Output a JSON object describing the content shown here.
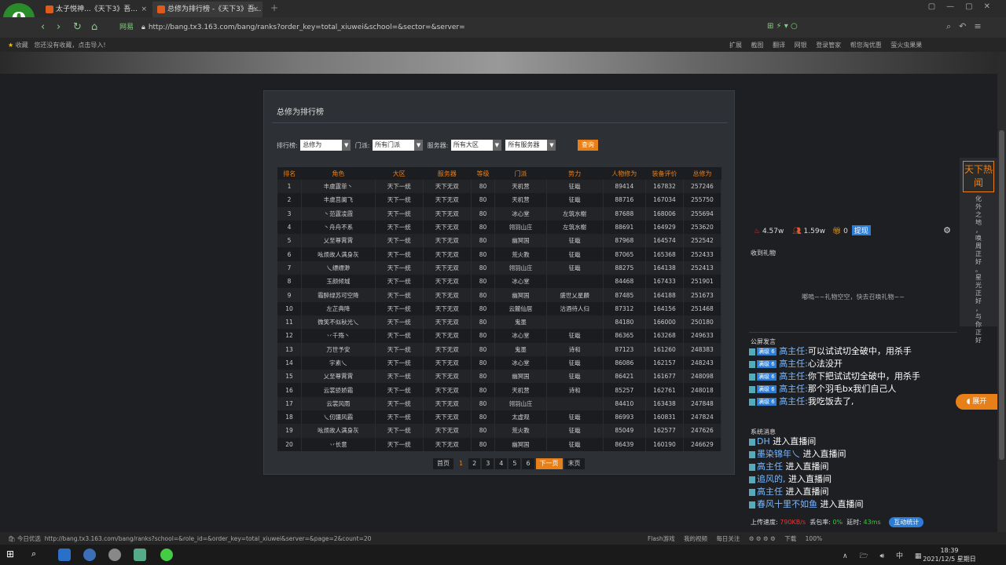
{
  "browser": {
    "logo": "e",
    "tabs": [
      {
        "label": "太子悦神...《天下3》吾..."
      },
      {
        "label": "总修为排行榜 -《天下3》吾..."
      }
    ],
    "url_prefix": "网易",
    "url": "http://bang.tx3.163.com/bang/ranks?order_key=total_xiuwei&school=&sector=&server=",
    "bookmarks_left_label": "收藏",
    "bookmarks_hint": "您还没有收藏，点击导入!",
    "bookmarks_right": [
      "扩展",
      "截图",
      "翻译",
      "网银",
      "登录管家",
      "帮您淘优惠",
      "萤火虫果果"
    ]
  },
  "panel": {
    "title": "总修为排行榜",
    "filters": {
      "rank_label": "排行榜:",
      "rank_value": "总修为",
      "school_label": "门派:",
      "school_value": "所有门派",
      "server_label": "服务器:",
      "region_value": "所有大区",
      "server_value": "所有服务器",
      "query": "查询"
    },
    "columns": [
      "排名",
      "角色",
      "大区",
      "服务器",
      "等级",
      "门派",
      "势力",
      "人物修为",
      "装备评价",
      "总修为"
    ],
    "rows": [
      [
        "1",
        "丰虞霆菲丶",
        "天下一统",
        "天下无双",
        "80",
        "天机营",
        "征戢",
        "89414",
        "167832",
        "257246"
      ],
      [
        "2",
        "丰虞莒阑飞",
        "天下一统",
        "天下无双",
        "80",
        "天机营",
        "征戢",
        "88716",
        "167034",
        "255750"
      ],
      [
        "3",
        "丶范霆凌霞",
        "天下一统",
        "天下无双",
        "80",
        "冰心堂",
        "左筑水榭",
        "87688",
        "168006",
        "255694"
      ],
      [
        "4",
        "丶舟舟不系",
        "天下一统",
        "天下无双",
        "80",
        "翎羽山庄",
        "左筑水榭",
        "88691",
        "164929",
        "253620"
      ],
      [
        "5",
        "乂至尊霄霄",
        "天下一统",
        "天下无双",
        "80",
        "幽冥国",
        "征戢",
        "87968",
        "164574",
        "252542"
      ],
      [
        "6",
        "吆烦故人满身灰",
        "天下一统",
        "天下无双",
        "80",
        "荒火教",
        "征戢",
        "87065",
        "165368",
        "252433"
      ],
      [
        "7",
        "乀缥缥渺",
        "天下一统",
        "天下无双",
        "80",
        "翎羽山庄",
        "征戢",
        "88275",
        "164138",
        "252413"
      ],
      [
        "8",
        "玉颜倾城",
        "天下一统",
        "天下无双",
        "80",
        "冰心堂",
        "",
        "84468",
        "167433",
        "251901"
      ],
      [
        "9",
        "霜醉绿苏可空降",
        "天下一统",
        "天下无双",
        "80",
        "幽冥国",
        "盛世乂星麟",
        "87485",
        "164188",
        "251673"
      ],
      [
        "10",
        "左芷典降",
        "天下一统",
        "天下无双",
        "80",
        "云麓仙居",
        "沽酒待人归",
        "87312",
        "164156",
        "251468"
      ],
      [
        "11",
        "微笑不似秋光乀",
        "天下一统",
        "天下无双",
        "80",
        "鬼墨",
        "",
        "84180",
        "166000",
        "250180"
      ],
      [
        "12",
        "丷千殇丶",
        "天下一统",
        "天下无双",
        "80",
        "冰心堂",
        "征戢",
        "86365",
        "163268",
        "249633"
      ],
      [
        "13",
        "万世予安",
        "天下一统",
        "天下无双",
        "80",
        "鬼墨",
        "诗和",
        "87123",
        "161260",
        "248383"
      ],
      [
        "14",
        "宇素乀",
        "天下一统",
        "天下无双",
        "80",
        "冰心堂",
        "征戢",
        "86086",
        "162157",
        "248243"
      ],
      [
        "15",
        "乂至尊霄霄",
        "天下一统",
        "天下无双",
        "80",
        "幽冥国",
        "征戢",
        "86421",
        "161677",
        "248098"
      ],
      [
        "16",
        "云裳骄娇霜",
        "天下一统",
        "天下无双",
        "80",
        "天机营",
        "诗和",
        "85257",
        "162761",
        "248018"
      ],
      [
        "17",
        "云裳风雨",
        "天下一统",
        "天下无双",
        "80",
        "翎羽山庄",
        "",
        "84410",
        "163438",
        "247848"
      ],
      [
        "18",
        "乀仞疆风霸",
        "天下一统",
        "天下无双",
        "80",
        "太虚观",
        "征戢",
        "86993",
        "160831",
        "247824"
      ],
      [
        "19",
        "吆烦故人满身灰",
        "天下一统",
        "天下无双",
        "80",
        "荒火教",
        "征戢",
        "85049",
        "162577",
        "247626"
      ],
      [
        "20",
        "丷长意",
        "天下一统",
        "天下无双",
        "80",
        "幽冥国",
        "征戢",
        "86439",
        "160190",
        "246629"
      ]
    ],
    "pager": {
      "first": "首页",
      "pages": [
        "1",
        "2",
        "3",
        "4",
        "5",
        "6"
      ],
      "current": "1",
      "next": "下一页",
      "last": "末页"
    }
  },
  "live": {
    "hot": "4.57w",
    "people": "1.59w",
    "gifts": "0",
    "withdraw": "提现",
    "gift_title": "收到礼物",
    "gift_empty": "嘟嗚~~礼物空空，快去召唤礼物~~",
    "public_title": "公屏发言",
    "chat": [
      {
        "level": "满级 6",
        "user": "高主任:",
        "msg": "可以试试切全破中，用杀手"
      },
      {
        "level": "满级 6",
        "user": "高主任:",
        "msg": "心法没开"
      },
      {
        "level": "满级 6",
        "user": "高主任:",
        "msg": "你下把试试切全破中，用杀手"
      },
      {
        "level": "满级 6",
        "user": "高主任:",
        "msg": "那个羽毛bx我们自己人"
      },
      {
        "level": "满级 6",
        "user": "高主任:",
        "msg": "我吃饭去了,"
      }
    ],
    "sys_title": "系统消息",
    "sys": [
      {
        "user": "DH",
        "msg": "进入直播间"
      },
      {
        "user": "墨染锦年乀",
        "msg": "进入直播间"
      },
      {
        "user": "高主任",
        "msg": "进入直播间"
      },
      {
        "user": "追风的,",
        "msg": "进入直播间"
      },
      {
        "user": "高主任",
        "msg": "进入直播间"
      },
      {
        "user": "春风十里不如鱼",
        "msg": "进入直播间"
      }
    ],
    "net": {
      "upload_label": "上传速度:",
      "upload": "790KB/s",
      "loss_label": "丢包率:",
      "loss": "0%",
      "delay_label": "延时:",
      "delay": "43ms",
      "btn": "互动统计"
    },
    "hot_badge": "天下热闻",
    "hot_text": "化外之地，唤周正好。星光正好，与你正好",
    "expand": "展开"
  },
  "status": {
    "left_label": "今日优选",
    "link": "http://bang.tx3.163.com/bang/ranks?school=&role_id=&order_key=total_xiuwei&server=&page=2&count=20",
    "right": [
      "Flash游戏",
      "我的视频",
      "每日关注",
      "下载",
      "100%"
    ]
  },
  "taskbar": {
    "time": "18:39",
    "date": "2021/12/5 星期日",
    "ime": "中"
  },
  "colors": {
    "accent": "#e8801a",
    "link": "#7ab8ff",
    "browser_green": "#2a8b2a"
  }
}
